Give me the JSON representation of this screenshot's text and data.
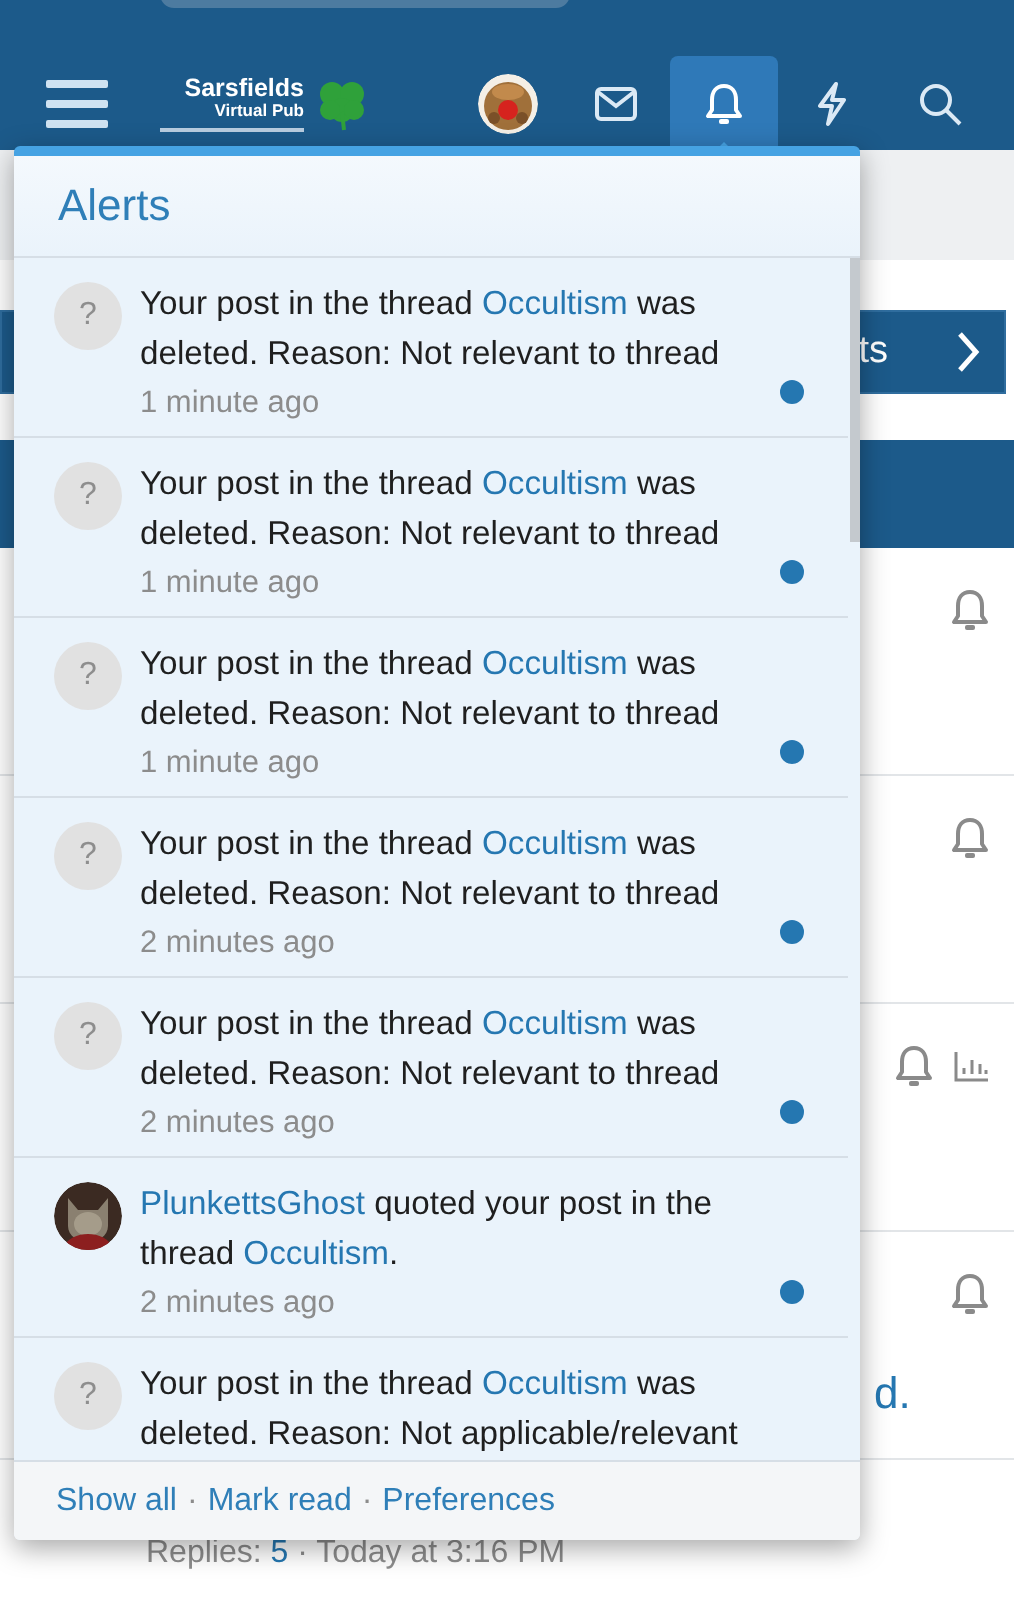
{
  "header": {
    "site_name": "Sarsfields",
    "site_subtitle": "Virtual Pub",
    "nav": [
      {
        "kind": "avatar",
        "selected": false
      },
      {
        "kind": "mail",
        "selected": false
      },
      {
        "kind": "bell",
        "selected": true
      },
      {
        "kind": "bolt",
        "selected": false
      },
      {
        "kind": "search",
        "selected": false
      }
    ]
  },
  "background_page": {
    "bar_text": "ts",
    "rows": [
      {
        "stats": false
      },
      {
        "stats": false
      },
      {
        "stats": true
      },
      {
        "stats": false,
        "title": "d.",
        "meta": [
          {
            "text": "Replies: ",
            "link": false
          },
          {
            "text": "5",
            "link": true
          },
          {
            "text": " · Today at 3:16 PM",
            "link": false
          }
        ]
      }
    ]
  },
  "alerts": {
    "title": "Alerts",
    "items": [
      {
        "kind": "placeholder",
        "avatar_text": "?",
        "segments": [
          {
            "text": "Your post in the thread ",
            "link": false
          },
          {
            "text": "Occultism",
            "link": true
          },
          {
            "text": " was deleted. Reason: Not relevant to thread",
            "link": false
          }
        ],
        "time": "1 minute ago",
        "unread": true
      },
      {
        "kind": "placeholder",
        "avatar_text": "?",
        "segments": [
          {
            "text": "Your post in the thread ",
            "link": false
          },
          {
            "text": "Occultism",
            "link": true
          },
          {
            "text": " was deleted. Reason: Not relevant to thread",
            "link": false
          }
        ],
        "time": "1 minute ago",
        "unread": true
      },
      {
        "kind": "placeholder",
        "avatar_text": "?",
        "segments": [
          {
            "text": "Your post in the thread ",
            "link": false
          },
          {
            "text": "Occultism",
            "link": true
          },
          {
            "text": " was deleted. Reason: Not relevant to thread",
            "link": false
          }
        ],
        "time": "1 minute ago",
        "unread": true
      },
      {
        "kind": "placeholder",
        "avatar_text": "?",
        "segments": [
          {
            "text": "Your post in the thread ",
            "link": false
          },
          {
            "text": "Occultism",
            "link": true
          },
          {
            "text": " was deleted. Reason: Not relevant to thread",
            "link": false
          }
        ],
        "time": "2 minutes ago",
        "unread": true
      },
      {
        "kind": "placeholder",
        "avatar_text": "?",
        "segments": [
          {
            "text": "Your post in the thread ",
            "link": false
          },
          {
            "text": "Occultism",
            "link": true
          },
          {
            "text": " was deleted. Reason: Not relevant to thread",
            "link": false
          }
        ],
        "time": "2 minutes ago",
        "unread": true
      },
      {
        "kind": "picture",
        "segments": [
          {
            "text": "PlunkettsGhost",
            "link": true
          },
          {
            "text": " quoted your post in the thread ",
            "link": false
          },
          {
            "text": "Occultism",
            "link": true
          },
          {
            "text": ".",
            "link": false
          }
        ],
        "time": "2 minutes ago",
        "unread": true
      },
      {
        "kind": "placeholder",
        "avatar_text": "?",
        "segments": [
          {
            "text": "Your post in the thread ",
            "link": false
          },
          {
            "text": "Occultism",
            "link": true
          },
          {
            "text": " was deleted. Reason: Not applicable/relevant",
            "link": false
          }
        ]
      }
    ],
    "footer_links": [
      "Show all",
      "Mark read",
      "Preferences"
    ],
    "separator": "·"
  }
}
